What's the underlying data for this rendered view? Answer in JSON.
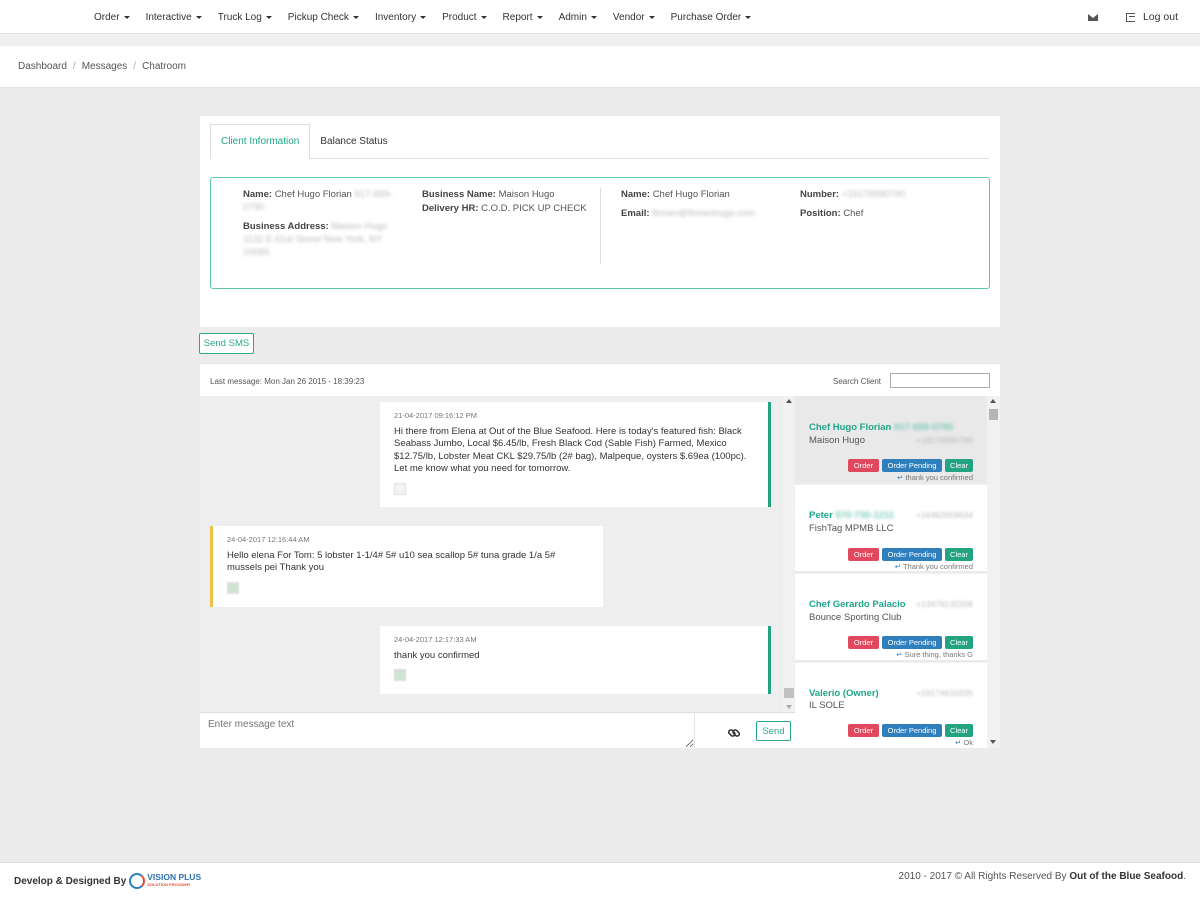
{
  "nav": {
    "items": [
      {
        "label": "Order"
      },
      {
        "label": "Interactive"
      },
      {
        "label": "Truck Log"
      },
      {
        "label": "Pickup Check"
      },
      {
        "label": "Inventory"
      },
      {
        "label": "Product"
      },
      {
        "label": "Report"
      },
      {
        "label": "Admin"
      },
      {
        "label": "Vendor"
      },
      {
        "label": "Purchase Order"
      }
    ],
    "logout_label": "Log out"
  },
  "breadcrumb": [
    "Dashboard",
    "Messages",
    "Chatroom"
  ],
  "tabs": [
    {
      "label": "Client Information",
      "active": true
    },
    {
      "label": "Balance Status",
      "active": false
    }
  ],
  "client_info": {
    "name_label": "Name:",
    "name_value": "Chef Hugo Florian",
    "name_phone": "917-699-0790",
    "business_address_label": "Business Address:",
    "business_address_value": "Maison Hugo 1132 E 61st Street New York, NY 10065",
    "business_name_label": "Business Name:",
    "business_name_value": "Maison Hugo",
    "delivery_hr_label": "Delivery HR:",
    "delivery_hr_value": "C.O.D. PICK UP CHECK",
    "contact_name_label": "Name:",
    "contact_name_value": "Chef Hugo Florian",
    "email_label": "Email:",
    "email_value": "florian@florianhugo.com",
    "number_label": "Number:",
    "number_value": "+19176990790",
    "position_label": "Position:",
    "position_value": "Chef"
  },
  "send_sms_label": "Send SMS",
  "chat": {
    "last_message": "Last message: Mon Jan 26 2015 - 18:39:23",
    "search_label": "Search Client",
    "search_value": "",
    "messages": [
      {
        "direction": "out",
        "time": "21-04-2017 09:16:12 PM",
        "text": "Hi there from Elena at Out of the Blue Seafood. Here is today's featured fish: Black Seabass Jumbo, Local $6.45/lb, Fresh Black Cod (Sable Fish) Farmed, Mexico $12.75/lb, Lobster Meat CKL $29.75/lb (2# bag), Malpeque, oysters $.69ea (100pc). Let me know what you need for tomorrow."
      },
      {
        "direction": "in",
        "time": "24-04-2017 12:16:44 AM",
        "text": "Hello elena For Tom: 5 lobster 1-1/4# 5# u10 sea scallop 5# tuna grade 1/a 5# mussels pei Thank you"
      },
      {
        "direction": "out",
        "time": "24-04-2017 12:17:33 AM",
        "text": "thank you confirmed"
      }
    ],
    "input_placeholder": "Enter message text",
    "send_label": "Send"
  },
  "clients": [
    {
      "name": "Chef Hugo Florian",
      "name_phone": "917-699-0790",
      "phone": "+19176990790",
      "business": "Maison Hugo",
      "last": "thank you confirmed",
      "active": true
    },
    {
      "name": "Peter",
      "name_phone": "570-730-1211",
      "phone": "+16462059634",
      "business": "FishTag MPMB LLC",
      "last": "Thank you confirmed",
      "active": false
    },
    {
      "name": "Chef Gerardo Palacio",
      "name_phone": "",
      "phone": "+13478132208",
      "business": "Bounce Sporting Club",
      "last": "Sure thing, thanks G",
      "active": false
    },
    {
      "name": "Valerio (Owner)",
      "name_phone": "",
      "phone": "+19174610335",
      "business": "IL SOLE",
      "last": "Ok",
      "active": false
    }
  ],
  "client_buttons": {
    "order": "Order",
    "pending": "Order Pending",
    "clear": "Clear"
  },
  "footer": {
    "left_text": "Develop & Designed By",
    "logo_main": "VISION PLUS",
    "logo_sub": "SOLUTION PROVIDER",
    "right_text": "2010 - 2017 © All Rights Reserved By",
    "right_company": "Out of the Blue Seafood",
    "right_end": "."
  },
  "colors": {
    "accent": "#1fa688",
    "order": "#e0485e",
    "pending": "#2f7fbd",
    "clear": "#22a383",
    "incoming": "#f0c04a"
  }
}
